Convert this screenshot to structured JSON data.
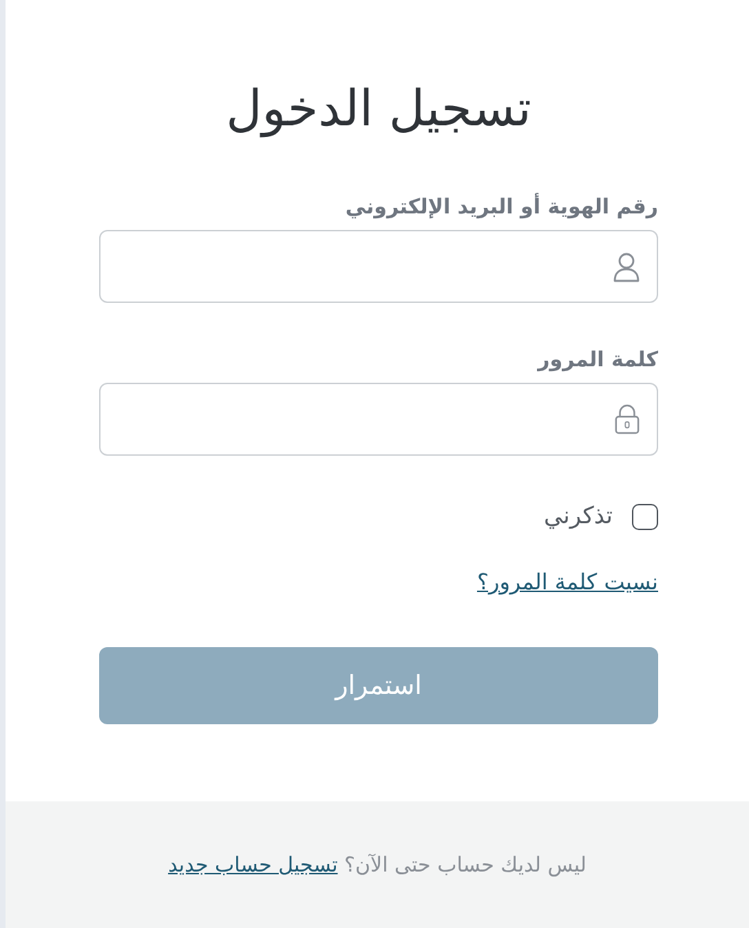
{
  "title": "تسجيل الدخول",
  "fields": [
    {
      "kind": "text",
      "label": "رقم الهوية أو البريد الإلكتروني"
    },
    {
      "kind": "password",
      "label": "كلمة المرور"
    }
  ],
  "remember": {
    "label": "تذكرني",
    "checked": false
  },
  "forgot_link": "نسيت كلمة المرور؟",
  "submit_button": "استمرار",
  "footer": {
    "text": "ليس لديك حساب حتى الآن؟",
    "link": "تسجيل حساب جديد"
  }
}
